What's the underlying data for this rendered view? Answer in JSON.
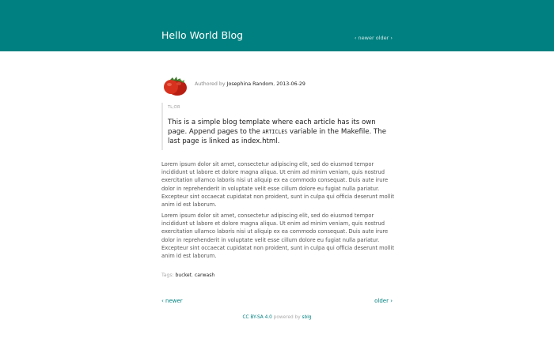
{
  "header": {
    "site_title": "Hello World Blog",
    "nav_prefix": "‹",
    "nav_newer": "newer",
    "nav_older": "older",
    "nav_suffix": "›",
    "bg_color": "#008080"
  },
  "article": {
    "avatar_icon": "tomato-icon",
    "authored_by": "Authored by",
    "author": "Josephina Random",
    "date": "2013-06-29",
    "tldr_label": "TL;DR",
    "summary_part1": "This is a simple blog template where each article has its own page. Append pages to the",
    "summary_code": "ARTICLES",
    "summary_part2": "variable in the Makefile. The last page is linked as index.html.",
    "paragraphs": [
      "Lorem ipsum dolor sit amet, consectetur adipiscing elit, sed do eiusmod tempor incididunt ut labore et dolore magna aliqua. Ut enim ad minim veniam, quis nostrud exercitation ullamco laboris nisi ut aliquip ex ea commodo consequat. Duis aute irure dolor in reprehenderit in voluptate velit esse cillum dolore eu fugiat nulla pariatur. Excepteur sint occaecat cupidatat non proident, sunt in culpa qui officia deserunt mollit anim id est laborum.",
      "Lorem ipsum dolor sit amet, consectetur adipiscing elit, sed do eiusmod tempor incididunt ut labore et dolore magna aliqua. Ut enim ad minim veniam, quis nostrud exercitation ullamco laboris nisi ut aliquip ex ea commodo consequat. Duis aute irure dolor in reprehenderit in voluptate velit esse cillum dolore eu fugiat nulla pariatur. Excepteur sint occaecat cupidatat non proident, sunt in culpa qui officia deserunt mollit anim id est laborum."
    ],
    "tags_label": "Tags:",
    "tags": [
      "bucket",
      "carwash"
    ]
  },
  "pager": {
    "newer": "‹ newer",
    "older": "older ›"
  },
  "footer": {
    "license": "CC BY-SA 4.0",
    "powered_by": "powered by",
    "engine": "sblg"
  }
}
